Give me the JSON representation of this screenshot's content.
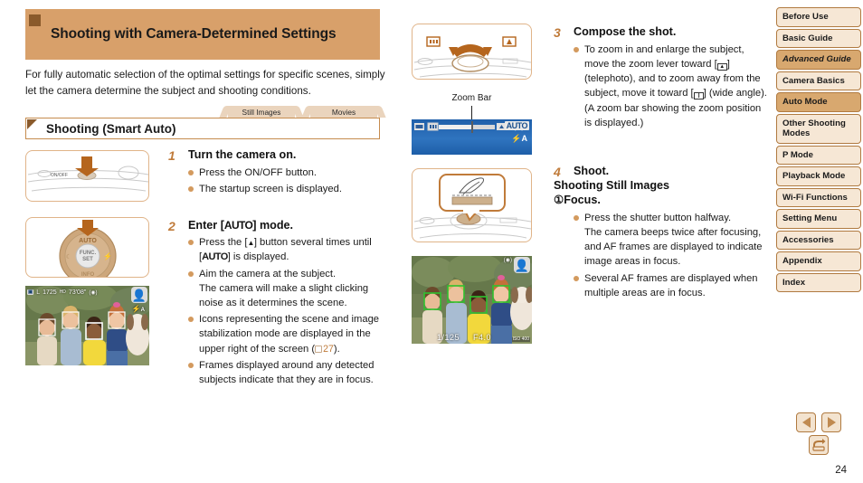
{
  "page": {
    "number": "24"
  },
  "header": {
    "title": "Shooting with Camera-Determined Settings",
    "intro": "For fully automatic selection of the optimal settings for specific scenes, simply let the camera determine the subject and shooting conditions.",
    "tabs": [
      {
        "label": "Still Images"
      },
      {
        "label": "Movies"
      }
    ],
    "subsection": "Shooting (Smart Auto)"
  },
  "steps": {
    "step1": {
      "num": "1",
      "title": "Turn the camera on.",
      "bullets": [
        "Press the ON/OFF button.",
        "The startup screen is displayed."
      ]
    },
    "step2": {
      "num": "2",
      "title_pre": "Enter [",
      "title_mode": "AUTO",
      "title_post": "] mode.",
      "bullet1_pre": "Press the [",
      "bullet1_key": "▲",
      "bullet1_mid": "] button several times until",
      "bullet1_line2_pre": "[",
      "bullet1_line2_mode": "AUTO",
      "bullet1_line2_post": "] is displayed.",
      "bullet2": "Aim the camera at the subject.",
      "bullet2_cont": "The camera will make a slight clicking noise as it determines the scene.",
      "bullet3_pre": "Icons representing the scene and image stabilization mode are displayed in the upper right of the screen (",
      "bullet3_ref": "27",
      "bullet3_post": ").",
      "bullet4": "Frames displayed around any detected subjects indicate that they are in focus."
    },
    "step3": {
      "num": "3",
      "title": "Compose the shot.",
      "bullet_part1": "To zoom in and enlarge the subject, move the zoom lever toward [",
      "bullet_icon_tele": "telephoto-icon",
      "bullet_part2": "] (telephoto), and to zoom away from the subject, move it toward [",
      "bullet_icon_wide": "wide-angle-icon",
      "bullet_part3": "] (wide angle). (A zoom bar showing the zoom position is displayed.)"
    },
    "step4": {
      "num": "4",
      "title": "Shoot.",
      "subtitle": "Shooting Still Images",
      "substep": "①",
      "substep_title": "Focus.",
      "bullet1": "Press the shutter button halfway.",
      "bullet1_cont": "The camera beeps twice after focusing, and AF frames are displayed to indicate image areas in focus.",
      "bullet2": "Several AF frames are displayed when multiple areas are in focus."
    }
  },
  "figures": {
    "zoom_bar_caption": "Zoom Bar",
    "onoff_label": "ON/OFF",
    "dial_func": "FUNC.",
    "dial_set": "SET",
    "dial_info": "INFO",
    "dial_top": "AUTO",
    "screen_osd": {
      "mode": "AUTO",
      "flash": "⚡A",
      "quality": "L",
      "shots": "1725",
      "movie_quality": "HD",
      "rec_time": "73'08\"",
      "exposure": "1/125",
      "aperture": "F4.0",
      "iso": "ISO 400"
    }
  },
  "sidebar": {
    "items": [
      {
        "label": "Before Use",
        "style": "light"
      },
      {
        "label": "Basic Guide",
        "style": "light"
      },
      {
        "label": "Advanced Guide",
        "style": "dark-italic"
      },
      {
        "label": "Camera Basics",
        "style": "light"
      },
      {
        "label": "Auto Mode",
        "style": "dark"
      },
      {
        "label": "Other Shooting Modes",
        "style": "light"
      },
      {
        "label": "P Mode",
        "style": "light"
      },
      {
        "label": "Playback Mode",
        "style": "light"
      },
      {
        "label": "Wi-Fi Functions",
        "style": "light"
      },
      {
        "label": "Setting Menu",
        "style": "light"
      },
      {
        "label": "Accessories",
        "style": "light"
      },
      {
        "label": "Appendix",
        "style": "light"
      },
      {
        "label": "Index",
        "style": "light"
      }
    ]
  },
  "footer": {
    "prev": "previous-page-arrow",
    "next": "next-page-arrow",
    "back": "return-arrow"
  },
  "colors": {
    "accent": "#d8a06a",
    "accent_dark": "#8a5a2b",
    "bullet": "#d39a5e",
    "border": "#c68c4e",
    "nav_dark": "#d8a86f",
    "nav_light": "#f6e7d5",
    "link": "#c07b3a",
    "screen_blue": "#2f74bf",
    "af_frame_green": "#2fc22f"
  }
}
